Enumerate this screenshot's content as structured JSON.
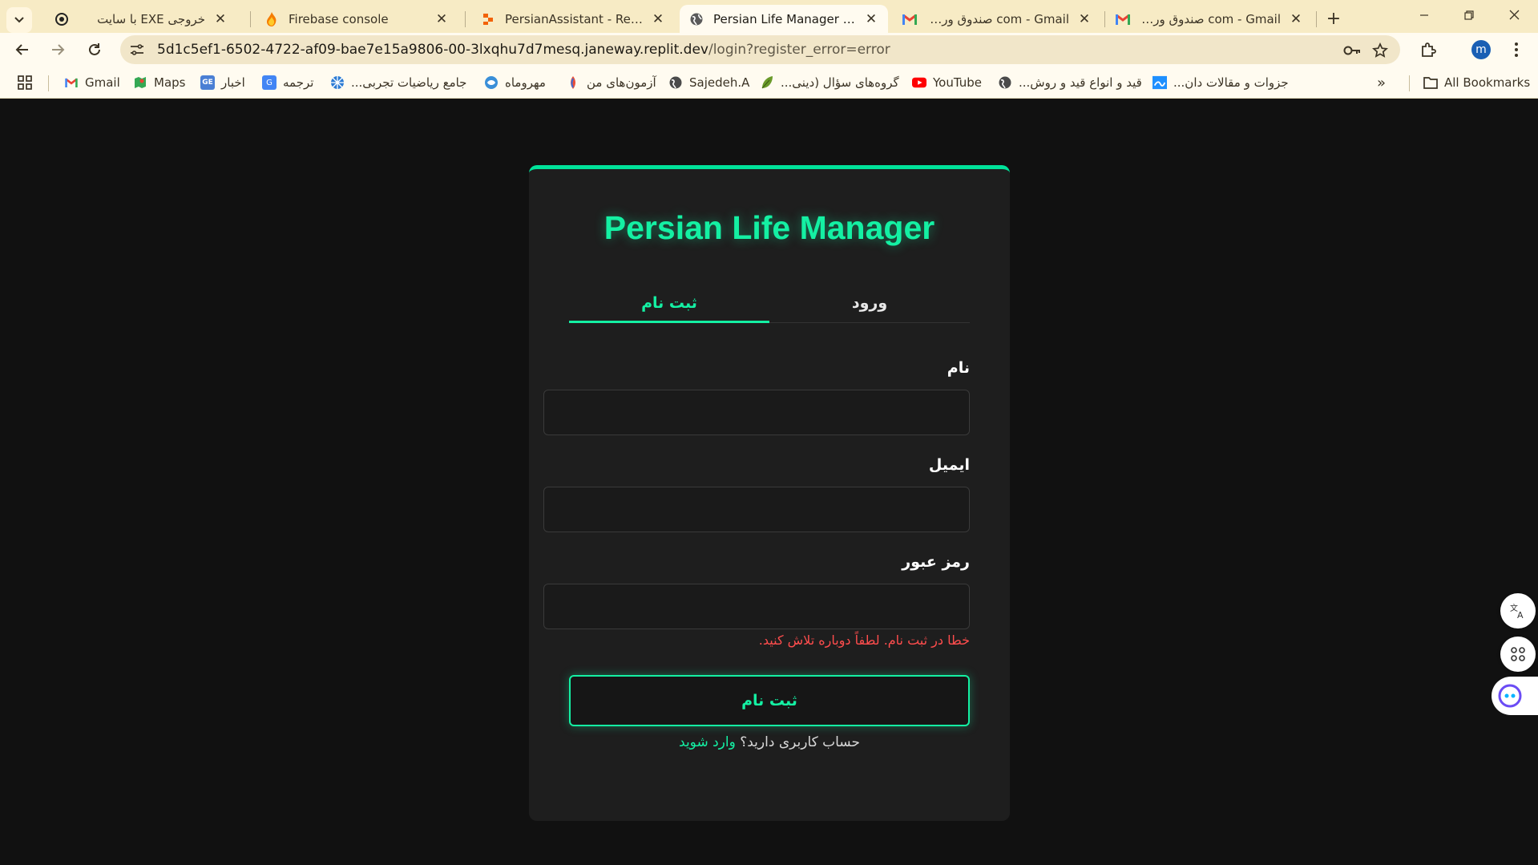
{
  "tabs": [
    {
      "title": "خروجی EXE با سایت",
      "icon": "openai-icon"
    },
    {
      "title": "Firebase console",
      "icon": "firebase-icon"
    },
    {
      "title": "PersianAssistant - Replit",
      "icon": "replit-icon"
    },
    {
      "title": "Persian Life Manager | ورود",
      "icon": "globe-icon",
      "active": true
    },
    {
      "title": "com - Gmail صندوق ورودی",
      "icon": "gmail-icon"
    },
    {
      "title": "com - Gmail صندوق ورودی",
      "icon": "gmail-icon"
    }
  ],
  "address": {
    "host": "5d1c5ef1-6502-4722-af09-bae7e15a9806-00-3lxqhu7d7mesq.janeway.replit.dev",
    "path": "/login?register_error=error"
  },
  "bookmarks": [
    {
      "label": "Gmail",
      "icon": "gmail-icon"
    },
    {
      "label": "Maps",
      "icon": "maps-icon"
    },
    {
      "label": "اخبار",
      "icon": "news-icon"
    },
    {
      "label": "ترجمه",
      "icon": "translate-icon"
    },
    {
      "label": "جامع ریاضیات تجربی...",
      "icon": "site-icon"
    },
    {
      "label": "مهروماه",
      "icon": "site-icon"
    },
    {
      "label": "آزمون‌های من",
      "icon": "site-icon"
    },
    {
      "label": "Sajedeh.A",
      "icon": "globe-icon"
    },
    {
      "label": "گروه‌های سؤال (دینی...",
      "icon": "leaf-icon"
    },
    {
      "label": "YouTube",
      "icon": "youtube-icon"
    },
    {
      "label": "قید و انواع قید و روش...",
      "icon": "globe-icon"
    },
    {
      "label": "جزوات و مقالات دان...",
      "icon": "site-icon"
    }
  ],
  "all_bookmarks": "All Bookmarks",
  "profile_initial": "m",
  "colors": {
    "accent": "#14f0a3",
    "error": "#ff4d4d",
    "background": "#111111",
    "card": "#1e1e1e"
  },
  "app": {
    "title": "Persian Life Manager",
    "tab_login": "ورود",
    "tab_register": "ثبت نام",
    "name_label": "نام",
    "email_label": "ایمیل",
    "password_label": "رمز عبور",
    "name_value": "",
    "email_value": "",
    "password_value": "",
    "error": "خطا در ثبت نام. لطفاً دوباره تلاش کنید.",
    "submit": "ثبت نام",
    "switch_text": "حساب کاربری دارید؟",
    "switch_link": "وارد شوید"
  }
}
